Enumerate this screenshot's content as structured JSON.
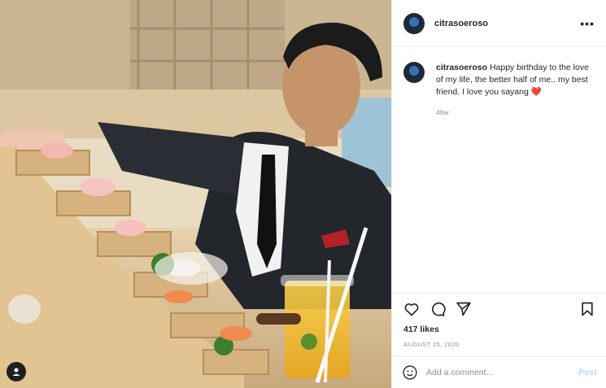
{
  "post": {
    "username": "citrasoeroso",
    "more_icon": "more-horizontal-icon",
    "caption_user": "citrasoeroso",
    "caption_text": "Happy birthday to the love of my life, the better half of me.. my best friend. I love you sayang",
    "caption_emoji": "❤️",
    "time_ago": "46w",
    "likes": "417 likes",
    "date": "AUGUST 25, 2020",
    "comment_placeholder": "Add a comment...",
    "post_label": "Post",
    "accent_color": "#0095f6"
  }
}
